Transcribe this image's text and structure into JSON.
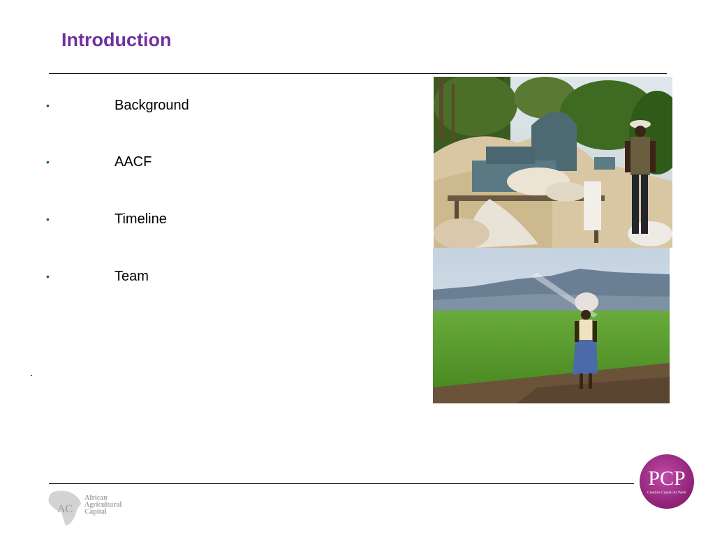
{
  "slide": {
    "title": "Introduction",
    "bullets": [
      "Background",
      "AACF",
      "Timeline",
      "Team"
    ],
    "bullet_glyph": "•",
    "accent_color": "#7030a0",
    "bullet_color": "#008000"
  },
  "images": {
    "top_photo": "workers-with-sacks-and-machine-photo",
    "bottom_photo": "woman-in-rice-field-photo"
  },
  "footer": {
    "left_logo_lines": [
      "African",
      "Agricultural",
      "Capital"
    ],
    "left_logo_mark": "AC",
    "right_logo_name": "PCP",
    "right_logo_tagline": "Creative Capital At Work"
  }
}
